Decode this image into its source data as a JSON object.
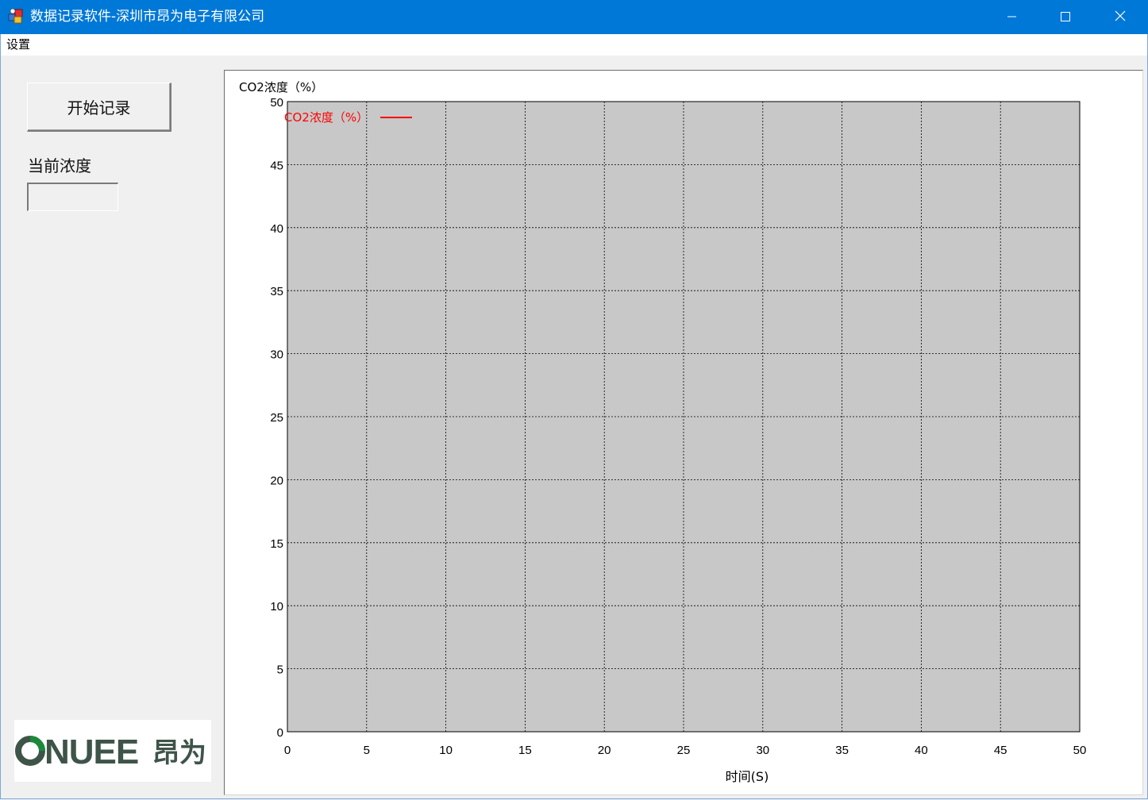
{
  "window": {
    "title": "数据记录软件-深圳市昂为电子有限公司",
    "controls": {
      "minimize": "minimize-icon",
      "maximize": "maximize-icon",
      "close": "close-icon"
    }
  },
  "menu": {
    "items": [
      {
        "label": "设置"
      }
    ]
  },
  "controls": {
    "start_button_label": "开始记录",
    "concentration_label": "当前浓度",
    "concentration_value": ""
  },
  "logo": {
    "text": "ONUEE昂为",
    "color": "#3f5449",
    "ring_color": "#1a8a3a"
  },
  "colors": {
    "titlebar": "#0078d7",
    "plot_background": "#c8c8c8",
    "series": "#ff0000"
  },
  "chart_data": {
    "type": "line",
    "ylabel": "CO2浓度（%）",
    "xlabel": "时间(S)",
    "xlim": [
      0,
      50
    ],
    "ylim": [
      0,
      50
    ],
    "x_ticks": [
      0,
      5,
      10,
      15,
      20,
      25,
      30,
      35,
      40,
      45,
      50
    ],
    "y_ticks": [
      0,
      5,
      10,
      15,
      20,
      25,
      30,
      35,
      40,
      45,
      50
    ],
    "grid": true,
    "legend_position": "top-left",
    "series": [
      {
        "name": "CO2浓度（%）",
        "color": "#ff0000",
        "x": [],
        "y": []
      }
    ]
  }
}
